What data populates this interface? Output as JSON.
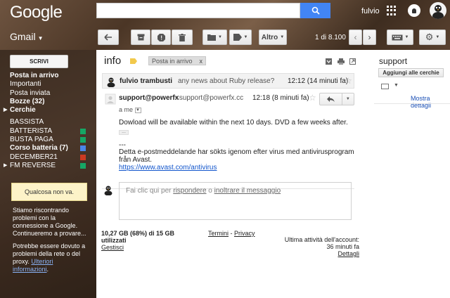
{
  "header": {
    "logo": "Google",
    "search_placeholder": "",
    "user": "fulvio"
  },
  "gmail_menu": "Gmail",
  "toolbar": {
    "more_label": "Altro",
    "pager": "1 di 8.100"
  },
  "sidebar": {
    "compose": "SCRIVI",
    "items": [
      {
        "label": "Posta in arrivo",
        "bold": true
      },
      {
        "label": "Importanti",
        "bold": false
      },
      {
        "label": "Posta inviata",
        "bold": false
      },
      {
        "label": "Bozze (32)",
        "bold": true
      },
      {
        "label": "Cerchie",
        "bold": true
      },
      {
        "label": "BASSISTA",
        "bold": false
      },
      {
        "label": "BATTERISTA",
        "bold": false,
        "color": "#16a765"
      },
      {
        "label": "BUSTA PAGA",
        "bold": false,
        "color": "#16a765"
      },
      {
        "label": "Corso batteria (7)",
        "bold": true,
        "color": "#4a86e8"
      },
      {
        "label": "DECEMBER21",
        "bold": false,
        "color": "#cc3a21"
      },
      {
        "label": "FM REVERSE",
        "bold": false,
        "color": "#16a765"
      }
    ],
    "chat_notice": "Qualcosa non va.",
    "problem_text": "Stiamo riscontrando problemi con la connessione a Google. Continueremo a provare...",
    "network_text": "Potrebbe essere dovuto a problemi della rete o del proxy.",
    "network_link": "Ulteriori informazioni",
    "network_suffix": "."
  },
  "thread": {
    "subject": "info",
    "label_chip": "Posta in arrivo",
    "chip_close": "x",
    "collapsed": {
      "from": "fulvio trambusti",
      "snippet": "any news about Ruby release?",
      "time": "12:12 (14 minuti fa)"
    },
    "open": {
      "from": "support@powerfx",
      "email": "<support@powerfx.cc",
      "time": "12:18 (8 minuti fa)",
      "to": "a me",
      "body1": "Dowload will be available within the next 10 days. DVD a few weeks after.",
      "dots": "...",
      "sig_sep": "---",
      "sig1": "Detta e-postmeddelande har sökts igenom efter virus med antivirusprogram",
      "sig2": "från Avast.",
      "link": "https://www.avast.com/antivirus"
    },
    "reply": {
      "prefix": "Fai clic qui per ",
      "reply_link": "rispondere",
      "mid": " o ",
      "forward_link": "inoltrare il messaggio"
    }
  },
  "footer": {
    "storage": "10,27 GB (68%) di 15 GB utilizzati",
    "manage": "Gestisci",
    "terms": "Termini",
    "sep": " - ",
    "privacy": "Privacy",
    "activity": "Ultima attività dell'account: 36 minuti fa",
    "details": "Dettagli"
  },
  "right_pane": {
    "title": "support",
    "add_circles": "Aggiungi alle cerchie",
    "more_details": "Mostra dettagli"
  },
  "colors": {
    "accent_blue": "#4285f4",
    "link_blue": "#1155cc",
    "label_yellow": "#f2c94c"
  }
}
